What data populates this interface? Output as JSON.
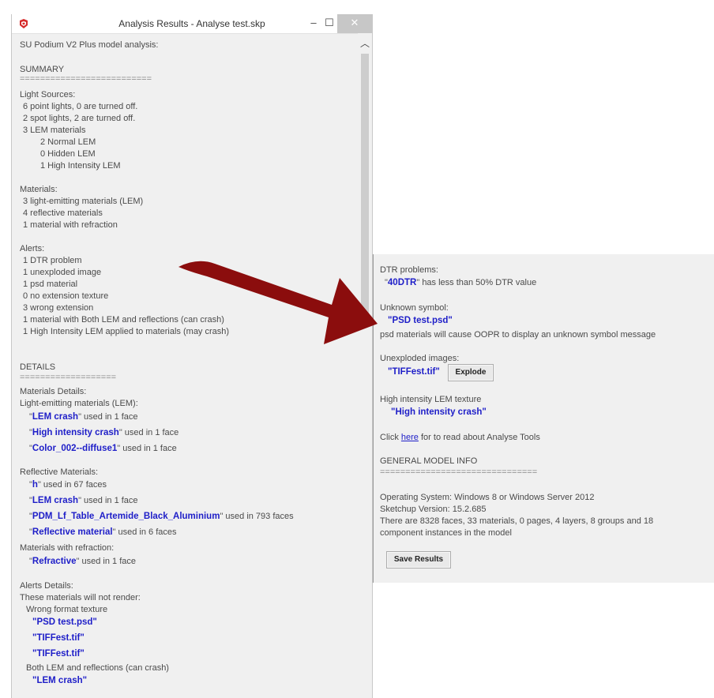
{
  "window": {
    "title": "Analysis Results - Analyse test.skp",
    "min_glyph": "–",
    "max_glyph": "☐",
    "close_glyph": "✕"
  },
  "left": {
    "heading": "SU Podium V2 Plus model analysis:",
    "summary_title": "SUMMARY",
    "summary_sep": "==========================",
    "light_sources_title": "Light Sources:",
    "light_sources": [
      "6 point lights, 0 are turned off.",
      "2 spot lights, 2 are turned off.",
      "3 LEM materials",
      "2 Normal LEM",
      "0 Hidden LEM",
      "1 High Intensity LEM"
    ],
    "materials_title": "Materials:",
    "materials": [
      "3 light-emitting materials (LEM)",
      "4 reflective materials",
      "1 material with refraction"
    ],
    "alerts_title": "Alerts:",
    "alerts": [
      "1 DTR problem",
      "1 unexploded image",
      "1 psd material",
      "0 no extension texture",
      "3 wrong extension",
      "1 material with Both LEM and reflections (can crash)",
      "1 High Intensity LEM applied to materials (may crash)"
    ],
    "details_title": "DETAILS",
    "details_sep": "===================",
    "materials_details_title": "Materials Details:",
    "lem_title": "Light-emitting materials (LEM):",
    "lem_items": [
      {
        "name": "LEM crash",
        "usage": "used in 1 face"
      },
      {
        "name": "High intensity crash",
        "usage": "used in 1 face"
      },
      {
        "name": "Color_002--diffuse1",
        "usage": "used in 1 face"
      }
    ],
    "reflective_title": "Reflective Materials:",
    "reflective_items": [
      {
        "name": "h",
        "usage": "used in 67 faces"
      },
      {
        "name": "LEM crash",
        "usage": "used in 1 face"
      },
      {
        "name": "PDM_Lf_Table_Artemide_Black_Aluminium",
        "usage": "used in 793 faces"
      },
      {
        "name": "Reflective material",
        "usage": "used in 6 faces"
      }
    ],
    "refraction_title": "Materials with refraction:",
    "refraction_items": [
      {
        "name": "Refractive",
        "usage": "used in 1 face"
      }
    ],
    "alerts_details_title": "Alerts Details:",
    "not_render_title": "These materials will not render:",
    "wrong_format_title": "Wrong format texture",
    "wrong_format_items": [
      "\"PSD test.psd\"",
      "\"TIFFest.tif\"",
      "\"TIFFest.tif\""
    ],
    "both_lem_title": "Both LEM and reflections (can crash)",
    "both_lem_items": [
      "\"LEM crash\""
    ]
  },
  "right": {
    "dtr_title": "DTR problems:",
    "dtr_name": "40DTR",
    "dtr_msg": "has less than 50% DTR value",
    "unknown_title": "Unknown symbol:",
    "unknown_name": "\"PSD test.psd\"",
    "unknown_msg": "psd materials will cause OOPR to display an unknown symbol message",
    "unexploded_title": "Unexploded images:",
    "unexploded_name": "\"TIFFest.tif\"",
    "explode_label": "Explode",
    "hi_title": "High intensity LEM texture",
    "hi_name": "\"High intensity crash\"",
    "click_pre": "Click",
    "click_link": "here",
    "click_post": "for to read about Analyse Tools",
    "general_title": "GENERAL MODEL INFO",
    "general_sep": "===============================",
    "os": "Operating System: Windows 8 or Windows Server 2012",
    "sketchup": "Sketchup Version: 15.2.685",
    "counts_line1": "There are 8328 faces, 33 materials, 0 pages, 4 layers, 8 groups and 18",
    "counts_line2": "component instances in the model",
    "save_label": "Save Results"
  },
  "colors": {
    "link": "#1e1ec8",
    "arrow": "#8b0d0d",
    "panel_bg": "#f0f0f0"
  }
}
